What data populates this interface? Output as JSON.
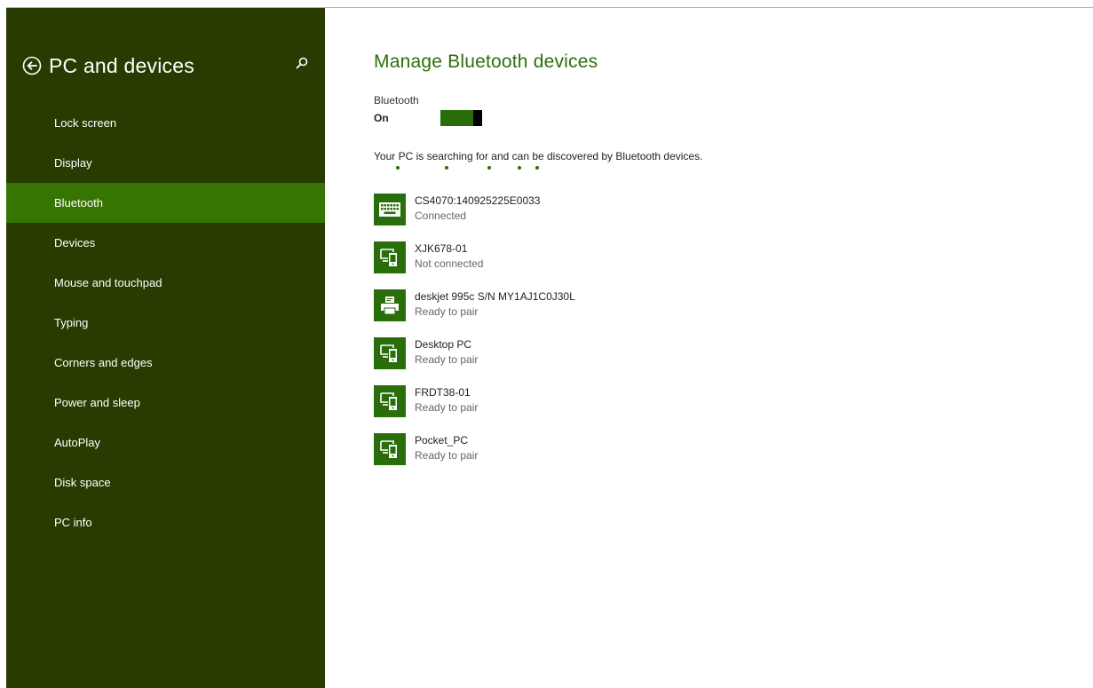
{
  "sidebar": {
    "title": "PC and devices",
    "items": [
      {
        "label": "Lock screen"
      },
      {
        "label": "Display"
      },
      {
        "label": "Bluetooth",
        "active": true
      },
      {
        "label": "Devices"
      },
      {
        "label": "Mouse and touchpad"
      },
      {
        "label": "Typing"
      },
      {
        "label": "Corners and edges"
      },
      {
        "label": "Power and sleep"
      },
      {
        "label": "AutoPlay"
      },
      {
        "label": "Disk space"
      },
      {
        "label": "PC info"
      }
    ],
    "icons": {
      "back": "back-arrow-icon",
      "search": "search-icon"
    }
  },
  "main": {
    "title": "Manage Bluetooth devices",
    "bluetooth_label": "Bluetooth",
    "bluetooth_state": "On",
    "toggle_on": true,
    "status_text": "Your PC is searching for and can be discovered by Bluetooth devices.",
    "devices": [
      {
        "name": "CS4070:140925225E0033",
        "status": "Connected",
        "icon": "keyboard-icon"
      },
      {
        "name": "XJK678-01",
        "status": "Not connected",
        "icon": "phone-pc-icon"
      },
      {
        "name": "deskjet 995c S/N MY1AJ1C0J30L",
        "status": "Ready to pair",
        "icon": "printer-icon"
      },
      {
        "name": "Desktop PC",
        "status": "Ready to pair",
        "icon": "phone-pc-icon"
      },
      {
        "name": "FRDT38-01",
        "status": "Ready to pair",
        "icon": "phone-pc-icon"
      },
      {
        "name": "Pocket_PC",
        "status": "Ready to pair",
        "icon": "phone-pc-icon"
      }
    ]
  },
  "colors": {
    "sidebar_bg": "#283c01",
    "sidebar_active": "#367501",
    "accent": "#2a6e0c",
    "title": "#2f6e0c"
  }
}
